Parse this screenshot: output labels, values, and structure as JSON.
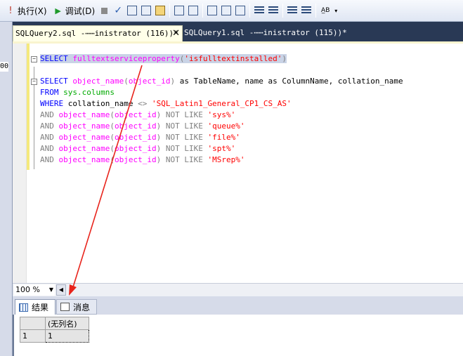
{
  "toolbar": {
    "execute_label": "执行(X)",
    "debug_label": "调试(D)"
  },
  "tabs": [
    {
      "label": "SQLQuery2.sql -⋯⋯inistrator (116))*",
      "active": true
    },
    {
      "label": "SQLQuery1.sql -⋯⋯inistrator (115))*",
      "active": false
    }
  ],
  "left_strip_text": "00",
  "editor": {
    "line1": [
      "SELECT",
      " ",
      "fulltextserviceproperty",
      "(",
      "'isfulltextinstalled'",
      ")"
    ],
    "line2": [
      "SELECT",
      " ",
      "object_name",
      "(",
      "object_id",
      ")",
      " as TableName, name as ColumnName, collation_name"
    ],
    "line3": [
      "FROM",
      " ",
      "sys.columns"
    ],
    "line4": [
      "WHERE",
      " collation_name ",
      "<>",
      " ",
      "'SQL_Latin1_General_CP1_CS_AS'"
    ],
    "not_like_lines": [
      {
        "and": "AND",
        "fn": "object_name",
        "arg": "object_id",
        "not": "NOT",
        "like": "LIKE",
        "pattern": "'sys%'"
      },
      {
        "and": "AND",
        "fn": "object_name",
        "arg": "object_id",
        "not": "NOT",
        "like": "LIKE",
        "pattern": "'queue%'"
      },
      {
        "and": "AND",
        "fn": "object_name",
        "arg": "object_id",
        "not": "NOT",
        "like": "LIKE",
        "pattern": "'file%'"
      },
      {
        "and": "AND",
        "fn": "object_name",
        "arg": "object_id",
        "not": "NOT",
        "like": "LIKE",
        "pattern": "'spt%'"
      },
      {
        "and": "AND",
        "fn": "object_name",
        "arg": "object_id",
        "not": "NOT",
        "like": "LIKE",
        "pattern": "'MSrep%'"
      }
    ]
  },
  "zoom": "100 %",
  "results_tabs": {
    "results_label": "结果",
    "messages_label": "消息"
  },
  "grid": {
    "column_header": "(无列名)",
    "row_number": "1",
    "value": "1"
  },
  "colors": {
    "annotation_arrow": "#e8241c",
    "selection": "#c9d3e6",
    "keyword": "#0000ff",
    "function": "#ff00ff",
    "string": "#ff0000"
  }
}
